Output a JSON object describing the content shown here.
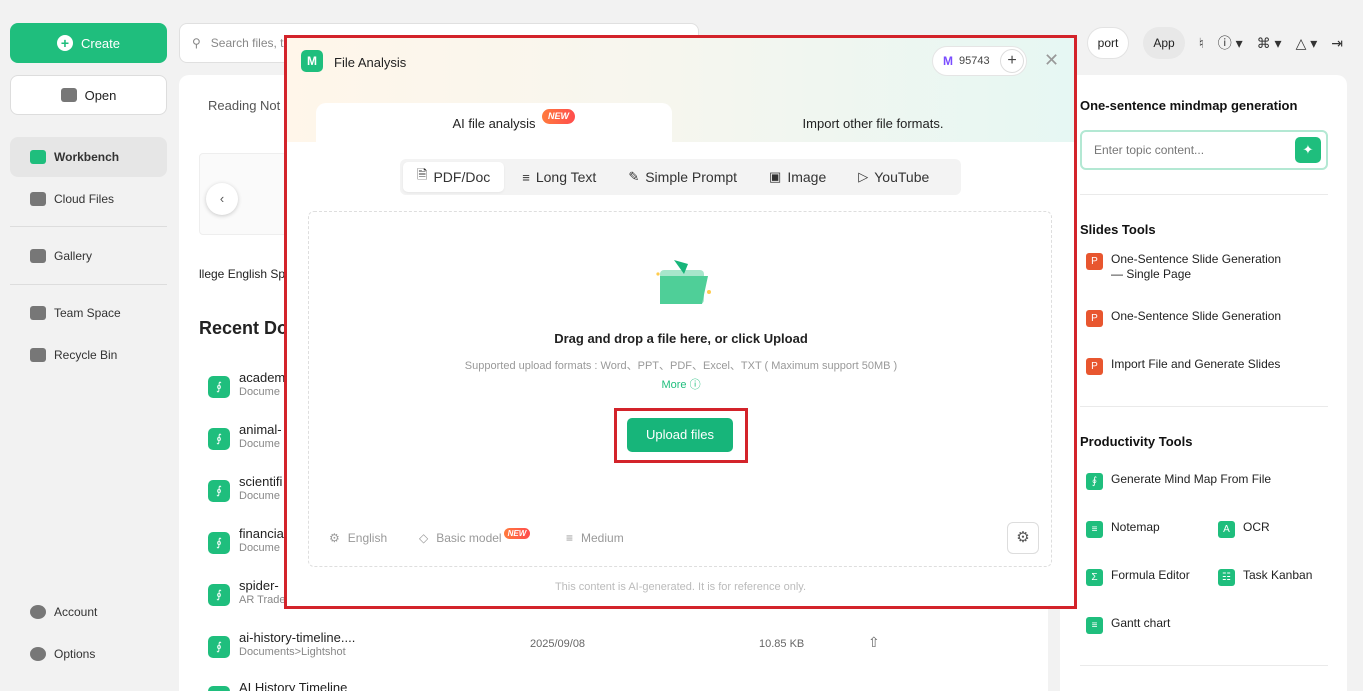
{
  "sidebar": {
    "create_label": "Create",
    "open_label": "Open",
    "items": [
      {
        "label": "Workbench"
      },
      {
        "label": "Cloud Files"
      },
      {
        "label": "Gallery"
      },
      {
        "label": "Team Space"
      },
      {
        "label": "Recycle Bin"
      }
    ],
    "bottom": [
      {
        "label": "Account"
      },
      {
        "label": "Options"
      }
    ]
  },
  "topbar": {
    "search_placeholder": "Search files, t",
    "import_label": "port",
    "app_label": "App"
  },
  "main": {
    "reading_tab": "Reading Not",
    "thumb_caption": "llege English Sp",
    "recent_title": "Recent Do",
    "docs": [
      {
        "name": "academ",
        "sub": "Docume",
        "date": "",
        "size": ""
      },
      {
        "name": "animal-",
        "sub": "Docume",
        "date": "",
        "size": ""
      },
      {
        "name": "scientifi",
        "sub": "Docume",
        "date": "",
        "size": ""
      },
      {
        "name": "financia",
        "sub": "Docume",
        "date": "",
        "size": ""
      },
      {
        "name": "spider-",
        "sub": "AR Trade",
        "date": "",
        "size": ""
      },
      {
        "name": "ai-history-timeline....",
        "sub": "Documents>Lightshot",
        "date": "2025/09/08",
        "size": "10.85 KB"
      },
      {
        "name": "AI History Timeline",
        "sub": "",
        "date": "",
        "size": ""
      }
    ]
  },
  "right_panel": {
    "mindmap_title": "One-sentence mindmap generation",
    "topic_placeholder": "Enter topic content...",
    "slides_title": "Slides Tools",
    "slides_tools": [
      {
        "label": "One-Sentence Slide Generation — Single Page"
      },
      {
        "label": "One-Sentence Slide Generation"
      },
      {
        "label": "Import File and Generate Slides"
      }
    ],
    "productivity_title": "Productivity Tools",
    "productivity_tools": [
      {
        "label": "Generate Mind Map From File"
      },
      {
        "label": "Notemap"
      },
      {
        "label": "OCR"
      },
      {
        "label": "Formula Editor"
      },
      {
        "label": "Task Kanban"
      },
      {
        "label": "Gantt chart"
      }
    ]
  },
  "modal": {
    "title": "File Analysis",
    "credits": "95743",
    "tab_ai": "AI file analysis",
    "tab_ai_badge": "NEW",
    "tab_import": "Import other file formats.",
    "subtabs": [
      {
        "label": "PDF/Doc",
        "icon": "document-icon"
      },
      {
        "label": "Long Text",
        "icon": "lines-icon"
      },
      {
        "label": "Simple Prompt",
        "icon": "prompt-icon"
      },
      {
        "label": "Image",
        "icon": "image-icon"
      },
      {
        "label": "YouTube",
        "icon": "youtube-icon"
      }
    ],
    "drop_title": "Drag and drop a file here, or click Upload",
    "drop_formats": "Supported upload formats : Word、PPT、PDF、Excel、TXT ( Maximum support 50MB )",
    "more_label": "More",
    "upload_label": "Upload files",
    "language": "English",
    "model": "Basic model",
    "model_badge": "NEW",
    "length": "Medium",
    "disclaimer": "This content is AI-generated. It is for reference only."
  },
  "colors": {
    "accent": "#1fbe7d",
    "highlight": "#d3232a"
  }
}
